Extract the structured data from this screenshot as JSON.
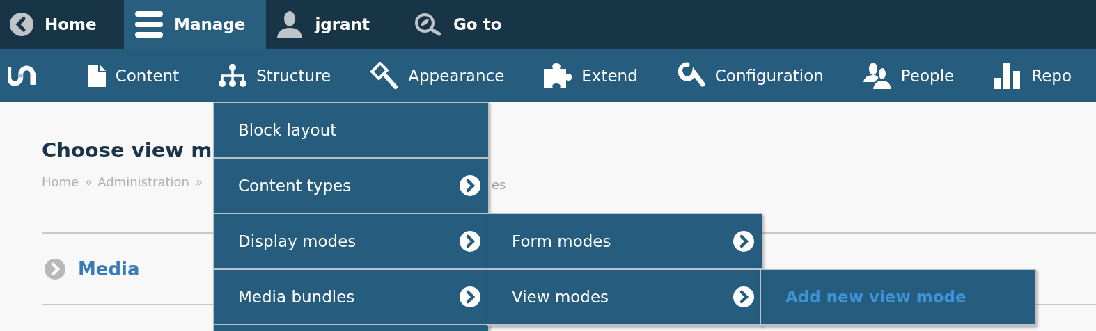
{
  "toolbar": {
    "tabs": [
      {
        "label": "Home",
        "selected": false
      },
      {
        "label": "Manage",
        "selected": true
      },
      {
        "label": "jgrant",
        "selected": false
      },
      {
        "label": "Go to",
        "selected": false
      }
    ]
  },
  "admin_menu": [
    {
      "label": "Content"
    },
    {
      "label": "Structure"
    },
    {
      "label": "Appearance"
    },
    {
      "label": "Extend"
    },
    {
      "label": "Configuration"
    },
    {
      "label": "People"
    },
    {
      "label": "Repo"
    }
  ],
  "page": {
    "title": "Choose view m",
    "breadcrumb": [
      "Home",
      "»",
      "Administration",
      "»"
    ],
    "breadcrumb_tail": "es",
    "sections": [
      {
        "label": "Media",
        "expanded": false
      }
    ]
  },
  "structure_menu": [
    {
      "label": "Block layout",
      "has_children": false,
      "active": false
    },
    {
      "label": "Content types",
      "has_children": true,
      "active": false
    },
    {
      "label": "Display modes",
      "has_children": true,
      "active": false,
      "children": [
        {
          "label": "Form modes",
          "has_children": true,
          "active": false
        },
        {
          "label": "View modes",
          "has_children": true,
          "active": false,
          "children": [
            {
              "label": "Add new view mode",
              "has_children": false,
              "active": true
            }
          ]
        }
      ]
    },
    {
      "label": "Media bundles",
      "has_children": true,
      "active": false
    }
  ]
}
